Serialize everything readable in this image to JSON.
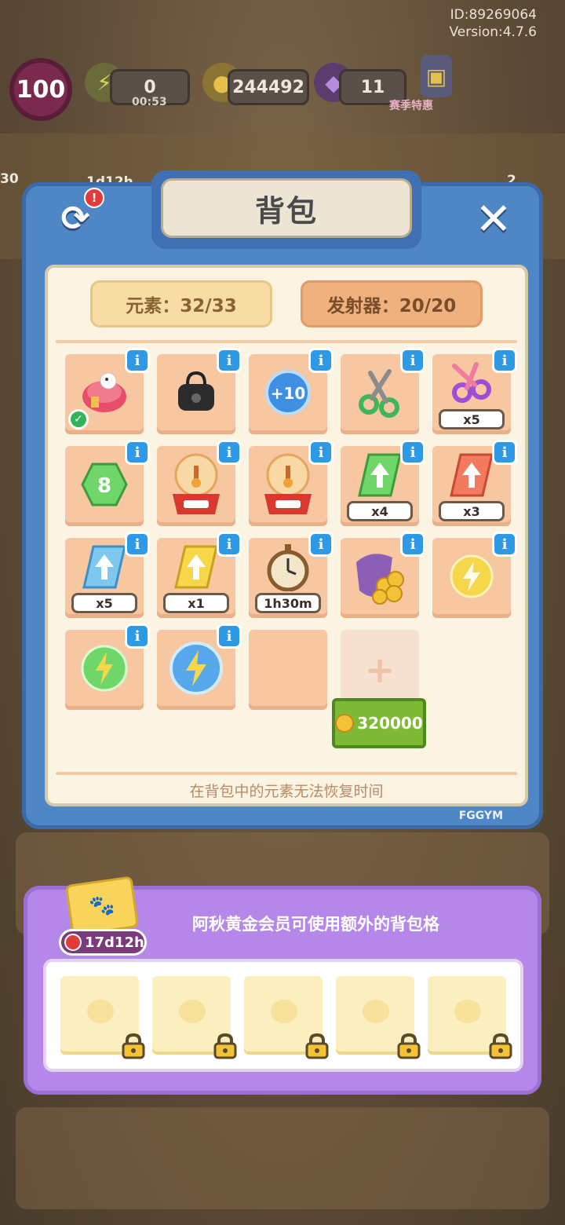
{
  "hud": {
    "id": "ID:89269064",
    "version": "Version:4.7.6",
    "level": "100",
    "energy": "0",
    "energy_timer": "00:53",
    "coins": "244492",
    "gems": "11",
    "promo": "赛季特惠",
    "event_timer": "1d12h",
    "left_num": "30",
    "right_num": "2"
  },
  "backpack": {
    "title": "背包",
    "tab_elements": "元素：32/33",
    "tab_launchers": "发射器：20/20",
    "footnote": "在背包中的元素无法恢复时间",
    "brand": "FGGYM",
    "price": "320000",
    "info_glyph": "i",
    "items": [
      {
        "icon": "scarf-bundle-icon",
        "count": null,
        "checked": true
      },
      {
        "icon": "black-bag-icon",
        "count": null
      },
      {
        "icon": "plus-ten-bubble-icon",
        "label": "+10",
        "count": null
      },
      {
        "icon": "green-scissors-icon",
        "count": null
      },
      {
        "icon": "purple-scissors-icon",
        "count": "x5"
      },
      {
        "icon": "green-hexagon-gem-icon",
        "count": null
      },
      {
        "icon": "claw-machine-icon",
        "count": null
      },
      {
        "icon": "claw-machine-icon",
        "count": null
      },
      {
        "icon": "green-upgrade-card-icon",
        "count": "x4"
      },
      {
        "icon": "red-upgrade-card-icon",
        "count": "x3"
      },
      {
        "icon": "blue-upgrade-card-icon",
        "count": "x5"
      },
      {
        "icon": "yellow-upgrade-card-icon",
        "count": "x1"
      },
      {
        "icon": "stopwatch-icon",
        "count": "1h30m"
      },
      {
        "icon": "coin-sack-icon",
        "count": null
      },
      {
        "icon": "yellow-energy-bubble-icon",
        "count": null
      },
      {
        "icon": "green-energy-bubble-icon",
        "count": null
      },
      {
        "icon": "blue-energy-bubble-icon",
        "count": null
      }
    ]
  },
  "member": {
    "text": "阿秋黄金会员可使用额外的背包格",
    "timer": "17d12h",
    "locked_slots": 5
  },
  "colors": {
    "panel_blue": "#4f86c6",
    "slot_peach": "#f7c7a2",
    "member_purple": "#b487e9",
    "info_blue": "#2e9ae6",
    "buy_green": "#7fba36"
  }
}
